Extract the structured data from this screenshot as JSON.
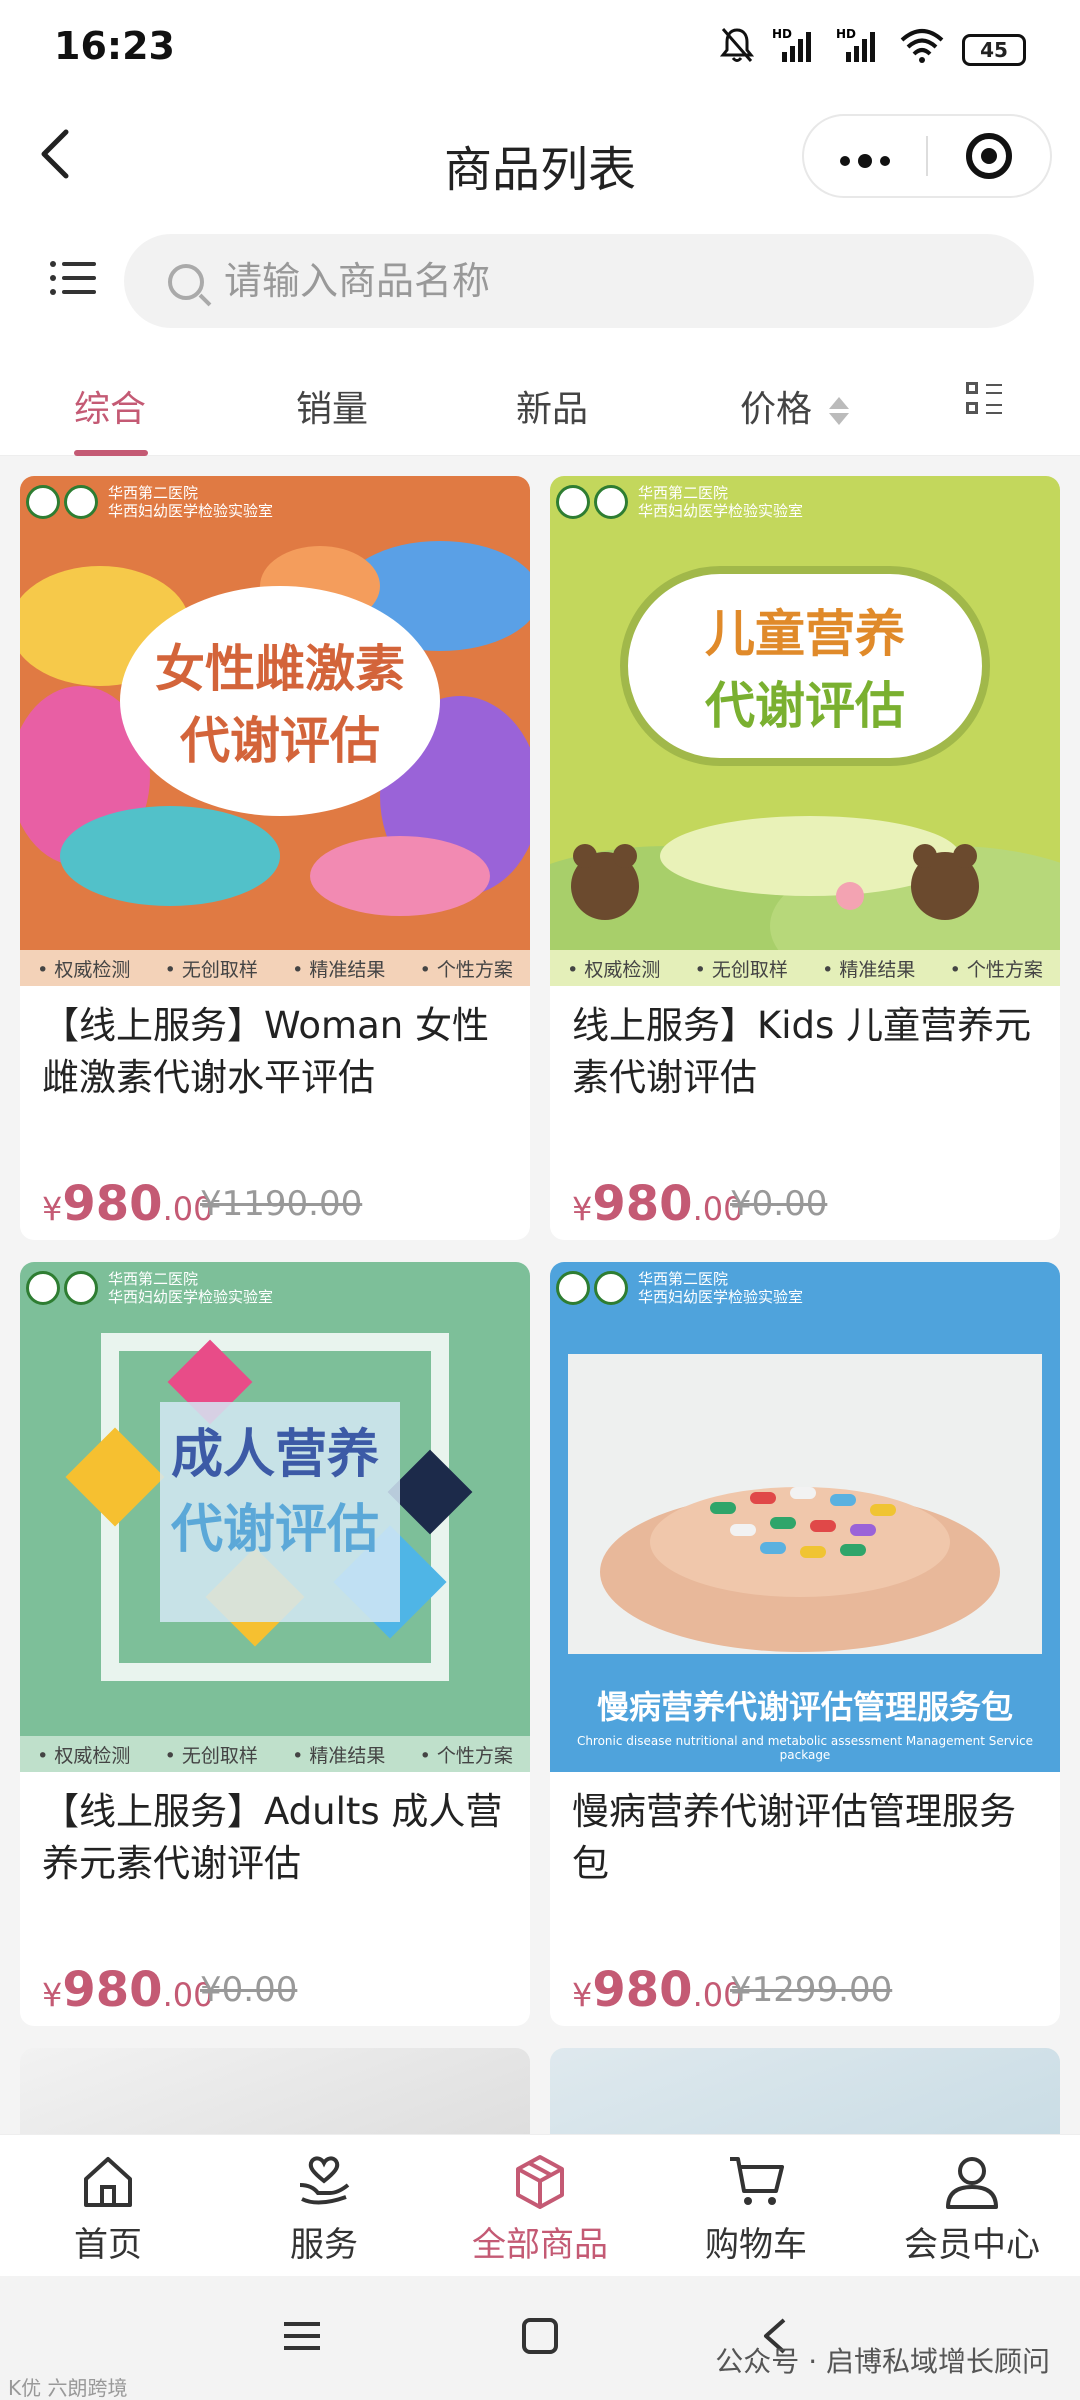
{
  "status_bar": {
    "time": "16:23",
    "battery": "45",
    "icons": [
      "bell-off-icon",
      "signal-hd-icon",
      "signal-hd-icon",
      "wifi-icon",
      "battery-icon"
    ]
  },
  "header": {
    "title": "商品列表",
    "back_icon": "chevron-left-icon",
    "more_icon": "more-dots-icon",
    "close_icon": "target-icon"
  },
  "search": {
    "placeholder": "请输入商品名称"
  },
  "tabs": [
    {
      "label": "综合",
      "active": true
    },
    {
      "label": "销量",
      "active": false
    },
    {
      "label": "新品",
      "active": false
    },
    {
      "label": "价格",
      "active": false
    }
  ],
  "colors": {
    "accent": "#c45a74",
    "background": "#f4f4f4"
  },
  "products": [
    {
      "name": "【线上服务】Woman 女性雌激素代谢水平评估",
      "price_symbol": "¥",
      "price_int": "980",
      "price_dec": ".00",
      "original_price": "¥1190.00",
      "image": {
        "hospital": "华西第二医院",
        "lab": "华西妇幼医学检验实验室",
        "title_line1": "女性雌激素",
        "title_line2": "代谢评估",
        "features": [
          "• 权威检测",
          "• 无创取样",
          "• 精准结果",
          "• 个性方案"
        ]
      }
    },
    {
      "name": "线上服务】Kids 儿童营养元素代谢评估",
      "price_symbol": "¥",
      "price_int": "980",
      "price_dec": ".00",
      "original_price": "¥0.00",
      "image": {
        "hospital": "华西第二医院",
        "lab": "华西妇幼医学检验实验室",
        "title_line1": "儿童营养",
        "title_line2": "代谢评估",
        "features": [
          "• 权威检测",
          "• 无创取样",
          "• 精准结果",
          "• 个性方案"
        ]
      }
    },
    {
      "name": "【线上服务】Adults 成人营养元素代谢评估",
      "price_symbol": "¥",
      "price_int": "980",
      "price_dec": ".00",
      "original_price": "¥0.00",
      "image": {
        "hospital": "华西第二医院",
        "lab": "华西妇幼医学检验实验室",
        "title_line1": "成人营养",
        "title_line2": "代谢评估",
        "features": [
          "• 权威检测",
          "• 无创取样",
          "• 精准结果",
          "• 个性方案"
        ]
      }
    },
    {
      "name": "慢病营养代谢评估管理服务包",
      "price_symbol": "¥",
      "price_int": "980",
      "price_dec": ".00",
      "original_price": "¥1299.00",
      "image": {
        "hospital": "华西第二医院",
        "lab": "华西妇幼医学检验实验室",
        "banner": "慢病营养代谢评估管理服务包",
        "banner_en": "Chronic disease nutritional and metabolic assessment Management Service package"
      }
    }
  ],
  "bottom_nav": [
    {
      "label": "首页",
      "icon": "home-icon",
      "active": false
    },
    {
      "label": "服务",
      "icon": "heart-hand-icon",
      "active": false
    },
    {
      "label": "全部商品",
      "icon": "box-icon",
      "active": true
    },
    {
      "label": "购物车",
      "icon": "cart-icon",
      "active": false
    },
    {
      "label": "会员中心",
      "icon": "user-icon",
      "active": false
    }
  ],
  "watermark": {
    "right": "公众号 · 启博私域增长顾问",
    "left": "K优 六朗跨境"
  }
}
